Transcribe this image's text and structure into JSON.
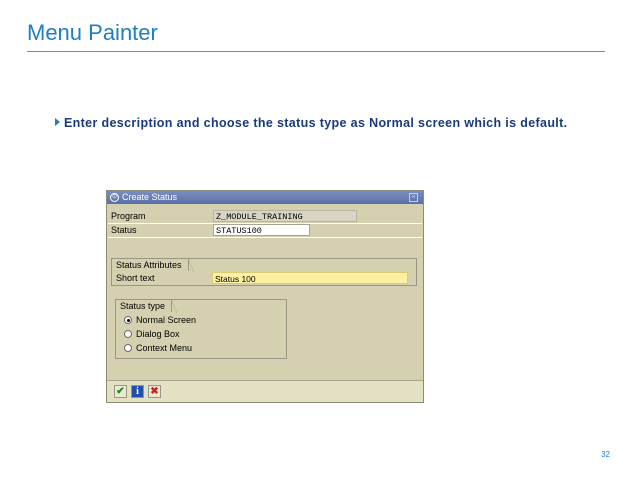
{
  "slide": {
    "title": "Menu Painter",
    "bullet": "Enter description and choose the status type as Normal screen which is default.",
    "page_number": "32"
  },
  "dialog": {
    "title": "Create Status",
    "program_label": "Program",
    "program_value": "Z_MODULE_TRAINING",
    "status_label": "Status",
    "status_value": "STATUS100",
    "attributes_group": "Status Attributes",
    "short_text_label": "Short text",
    "short_text_value": "Status 100",
    "status_type_group": "Status type",
    "status_types": [
      {
        "label": "Normal Screen",
        "selected": true
      },
      {
        "label": "Dialog Box",
        "selected": false
      },
      {
        "label": "Context Menu",
        "selected": false
      }
    ],
    "buttons": {
      "ok": "✔",
      "info": "i",
      "cancel": "✖"
    }
  },
  "colors": {
    "accent": "#1f7fbf",
    "dialog_bg": "#d4d0b0",
    "titlebar": "#5a6ea8",
    "highlight_field": "#fdf0a0"
  }
}
